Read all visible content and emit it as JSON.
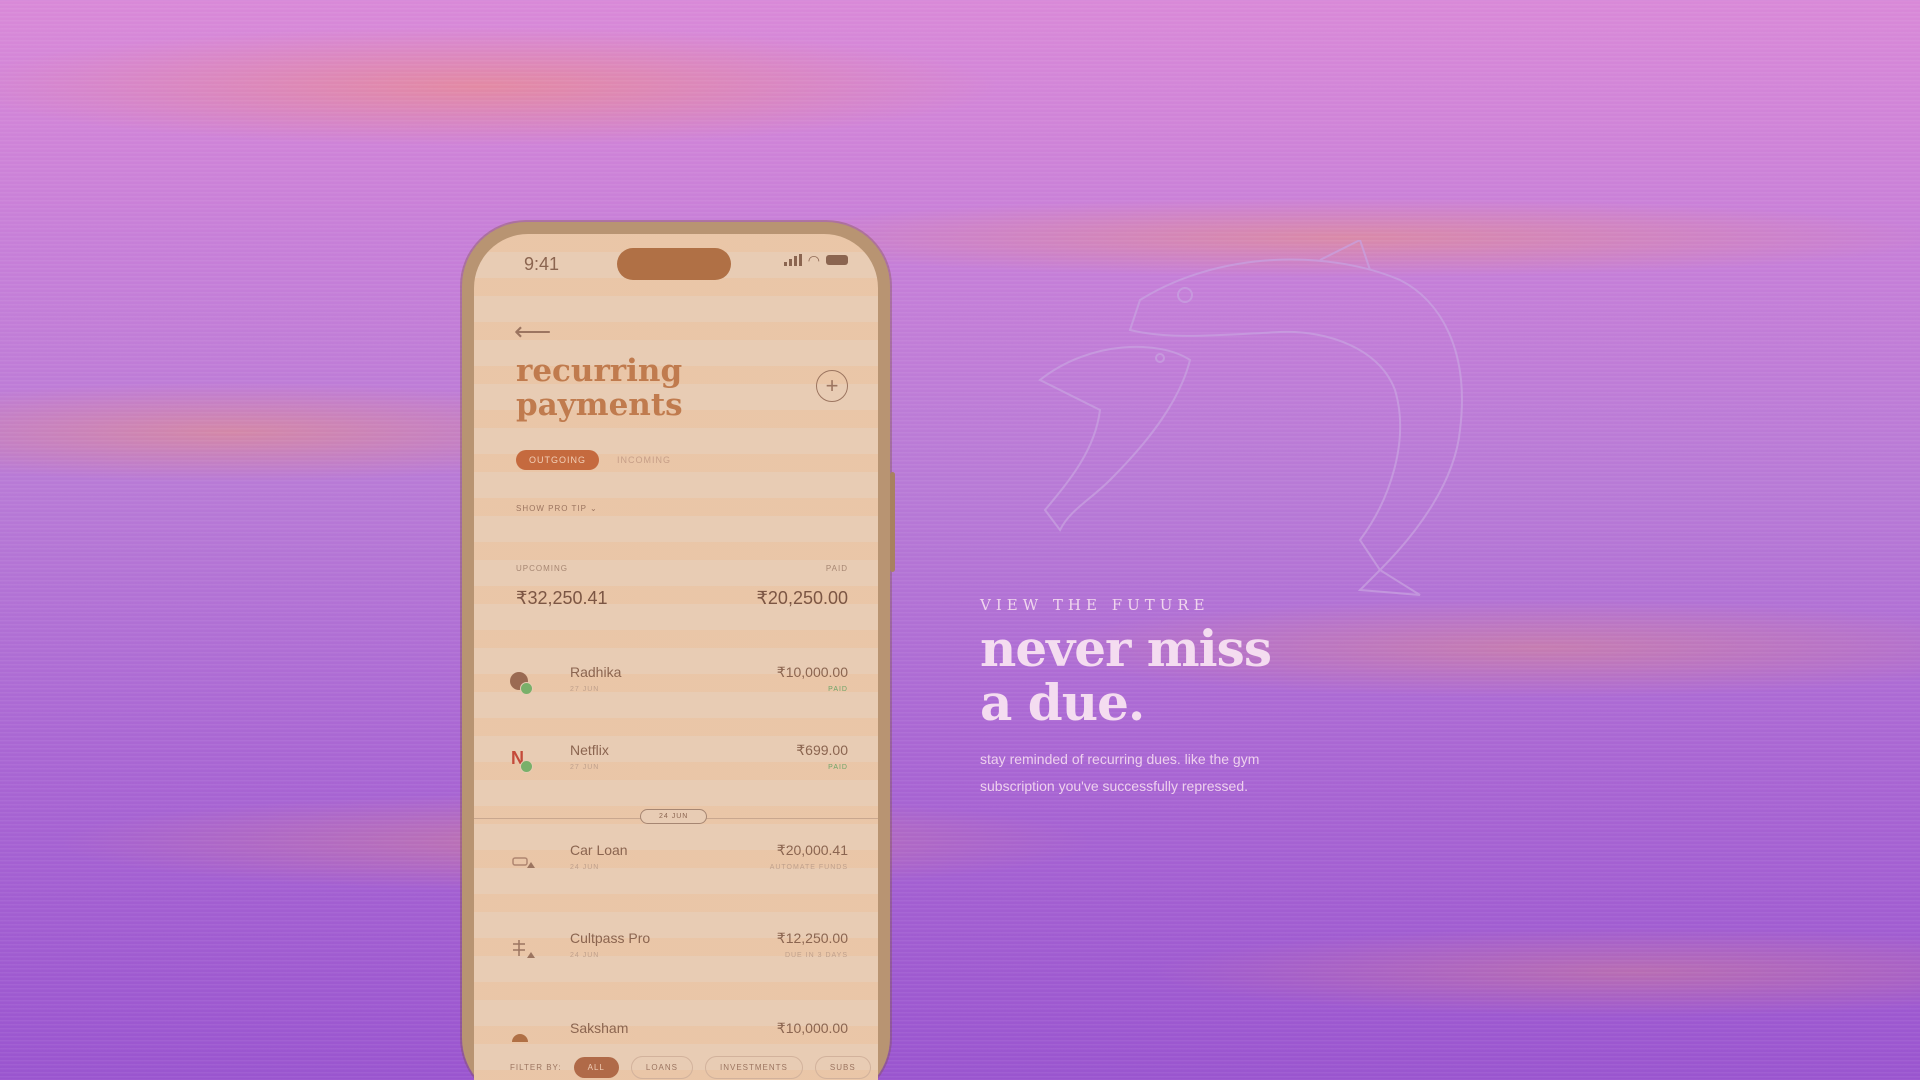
{
  "phone": {
    "status_time": "9:41",
    "title": "recurring payments",
    "tabs": {
      "active": "OUTGOING",
      "inactive": "INCOMING"
    },
    "pro_tip": "SHOW PRO TIP ⌄",
    "summary": {
      "upcoming_label": "UPCOMING",
      "paid_label": "PAID",
      "upcoming_value": "₹32,250.41",
      "paid_value": "₹20,250.00"
    },
    "payments": [
      {
        "name": "Radhika",
        "date": "27 JUN",
        "amount": "₹10,000.00",
        "status": "PAID"
      },
      {
        "name": "Netflix",
        "date": "27 JUN",
        "amount": "₹699.00",
        "status": "PAID"
      },
      {
        "name": "Car Loan",
        "date": "24 JUN",
        "amount": "₹20,000.41",
        "status": "AUTOMATE FUNDS"
      },
      {
        "name": "Cultpass Pro",
        "date": "24 JUN",
        "amount": "₹12,250.00",
        "status": "DUE IN 3 DAYS"
      },
      {
        "name": "Saksham",
        "amount": "₹10,000.00"
      }
    ],
    "date_divider": "24 JUN",
    "filter": {
      "label": "FILTER BY:",
      "chips": [
        "ALL",
        "LOANS",
        "INVESTMENTS",
        "SUBS"
      ]
    }
  },
  "hero": {
    "eyebrow": "VIEW THE FUTURE",
    "headline": "never miss a due.",
    "subtext": "stay reminded of recurring dues. like the gym subscription you've successfully repressed."
  },
  "colors": {
    "background": "#b87ad6",
    "phone_screen": "#e8ccb4",
    "accent": "#c56a3e",
    "paid_green": "#6ea468"
  }
}
